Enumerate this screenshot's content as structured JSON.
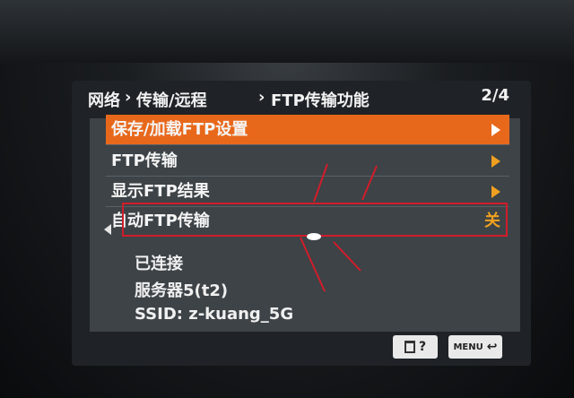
{
  "header": {
    "crumb1": "网络",
    "crumb2": "传输/远程",
    "crumb3": "FTP传输功能",
    "page": "2/4"
  },
  "menu": [
    {
      "label": "保存/加载FTP设置",
      "selected": true,
      "right": ""
    },
    {
      "label": "FTP传输",
      "selected": false,
      "right": ""
    },
    {
      "label": "显示FTP结果",
      "selected": false,
      "right": ""
    },
    {
      "label": "自动FTP传输",
      "selected": false,
      "right": "关"
    }
  ],
  "status": {
    "connection": "已连接",
    "server": "服务器5(t2)",
    "ssid": "SSID: z-kuang_5G"
  },
  "footer": {
    "delete_help_label": "?",
    "menu_label": "MENU"
  },
  "colors": {
    "selected_row": "#e8681b",
    "value_text": "#f0a020",
    "annotation": "#d21c2a"
  }
}
